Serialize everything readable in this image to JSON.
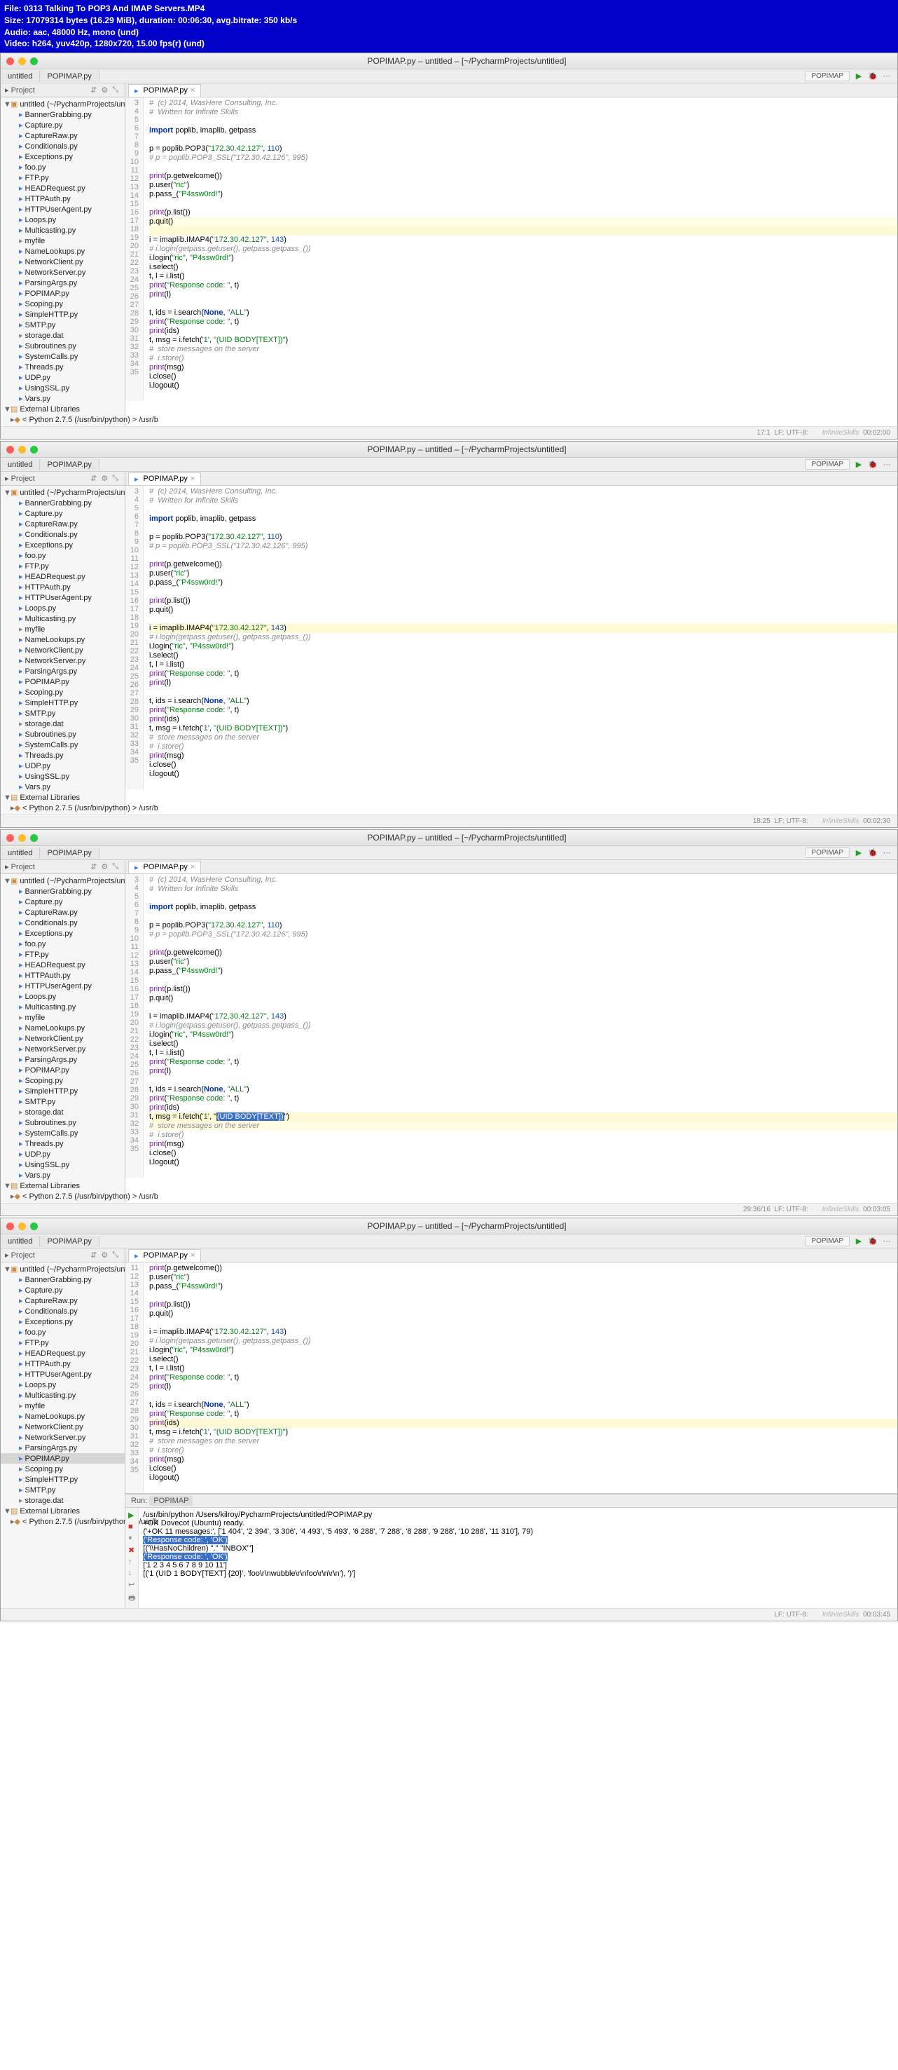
{
  "media_info": {
    "l1": "File: 0313 Talking To POP3 And IMAP Servers.MP4",
    "l2": "Size: 17079314 bytes (16.29 MiB), duration: 00:06:30, avg.bitrate: 350 kb/s",
    "l3": "Audio: aac, 48000 Hz, mono (und)",
    "l4": "Video: h264, yuv420p, 1280x720, 15.00 fps(r) (und)"
  },
  "titlebar": "POPIMAP.py – untitled – [~/PycharmProjects/untitled]",
  "breadcrumb_untitled": "untitled",
  "breadcrumb_file": "POPIMAP.py",
  "run_config": "POPIMAP",
  "project_label": "Project",
  "root_label": "untitled (~/PycharmProjects/untitled)",
  "ext_lib_label": "External Libraries",
  "python_label": "< Python 2.7.5 (/usr/bin/python) > /usr/b",
  "files_full": [
    "BannerGrabbing.py",
    "Capture.py",
    "CaptureRaw.py",
    "Conditionals.py",
    "Exceptions.py",
    "foo.py",
    "FTP.py",
    "HEADRequest.py",
    "HTTPAuth.py",
    "HTTPUserAgent.py",
    "Loops.py",
    "Multicasting.py",
    "myfile",
    "NameLookups.py",
    "NetworkClient.py",
    "NetworkServer.py",
    "ParsingArgs.py",
    "POPIMAP.py",
    "Scoping.py",
    "SimpleHTTP.py",
    "SMTP.py",
    "storage.dat",
    "Subroutines.py",
    "SystemCalls.py",
    "Threads.py",
    "UDP.py",
    "UsingSSL.py",
    "Vars.py"
  ],
  "files_shift1": [
    "BannerGrabbing.py",
    "Capture.py",
    "CaptureRaw.py",
    "Conditionals.py",
    "Exceptions.py",
    "foo.py",
    "FTP.py",
    "HEADRequest.py",
    "HTTPAuth.py",
    "HTTPUserAgent.py",
    "Loops.py",
    "Multicasting.py",
    "myfile",
    "NameLookups.py",
    "NetworkClient.py",
    "NetworkServer.py",
    "ParsingArgs.py",
    "POPIMAP.py",
    "Scoping.py",
    "SimpleHTTP.py",
    "SMTP.py",
    "storage.dat",
    "Subroutines.py",
    "SystemCalls.py",
    "Threads.py",
    "UDP.py",
    "UsingSSL.py",
    "Vars.py"
  ],
  "code_lines": {
    "3": "#  (c) 2014, WasHere Consulting, Inc.",
    "4": "#  Written for Infinite Skills",
    "5": "",
    "6": "import poplib, imaplib, getpass",
    "7": "",
    "8": "p = poplib.POP3(\"172.30.42.127\", 110)",
    "9": "# p = poplib.POP3_SSL(\"172.30.42.126\", 995)",
    "10": "",
    "11": "print(p.getwelcome())",
    "12": "p.user(\"ric\")",
    "13": "p.pass_(\"P4ssw0rd!\")",
    "14": "",
    "15": "print(p.list())",
    "16": "p.quit()",
    "17": "",
    "18": "i = imaplib.IMAP4(\"172.30.42.127\", 143)",
    "19": "# i.login(getpass.getuser(), getpass.getpass_())",
    "20": "i.login(\"ric\", \"P4ssw0rd!\")",
    "21": "i.select()",
    "22": "t, l = i.list()",
    "23": "print(\"Response code: \", t)",
    "24": "print(l)",
    "25": "",
    "26": "t, ids = i.search(None, \"ALL\")",
    "27": "print(\"Response code: \", t)",
    "28": "print(ids)",
    "29": "t, msg = i.fetch('1', \"(UID BODY[TEXT])\")",
    "30": "#  store messages on the server",
    "31": "#  i.store()",
    "32": "print(msg)",
    "33": "i.close()",
    "34": "i.logout()",
    "35": ""
  },
  "status": {
    "p1": {
      "pos": "17:1",
      "enc": "LF: UTF-8:",
      "time": "00:02:00"
    },
    "p2": {
      "pos": "18:25",
      "enc": "LF: UTF-8:",
      "time": "00:02:30"
    },
    "p3": {
      "pos": "29:36/16",
      "enc": "LF: UTF-8:",
      "time": "00:03:05"
    },
    "p4": {
      "enc": "LF: UTF-8:",
      "time": "00:03:45"
    }
  },
  "run": {
    "label": "Run:",
    "tab": "POPIMAP",
    "lines": [
      "/usr/bin/python /Users/kilroy/PycharmProjects/untitled/POPIMAP.py",
      "+OK Dovecot (Ubuntu) ready.",
      "('+OK 11 messages:', ['1 404', '2 394', '3 306', '4 493', '5 493', '6 288', '7 288', '8 288', '9 288', '10 288', '11 310'], 79)",
      "('Response code: ', 'OK')",
      "[('\\\\HasNoChildren) \".\" \"INBOX\"']",
      "('Response code: ', 'OK')",
      "['1 2 3 4 5 6 7 8 9 10 11']",
      "[('1 (UID 1 BODY[TEXT] {20}', 'foo\\r\\nwubble\\r\\nfoo\\r\\n\\r\\n'), ')']"
    ]
  },
  "watermark": "InfiniteSkills"
}
